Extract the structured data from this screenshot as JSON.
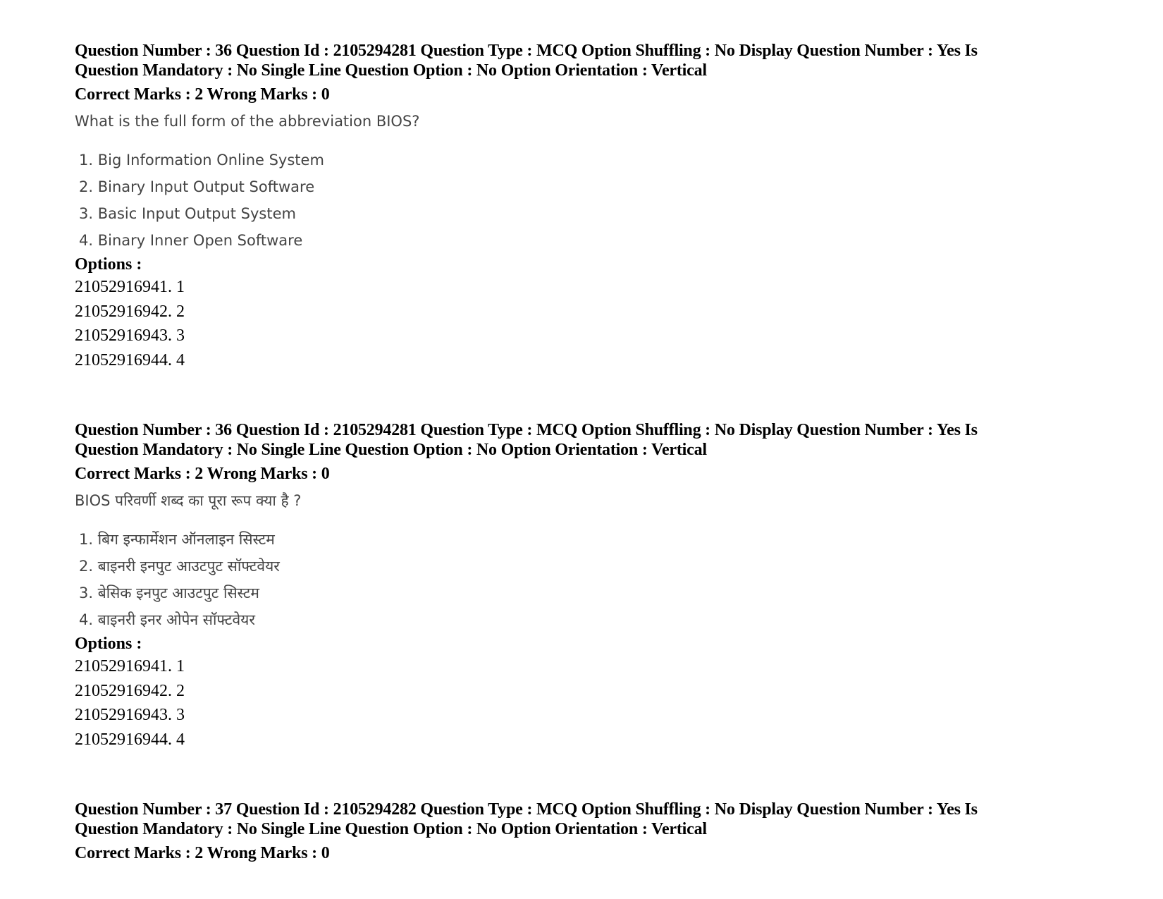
{
  "questions": [
    {
      "header_line1": "Question Number : 36 Question Id : 2105294281 Question Type : MCQ Option Shuffling : No Display Question Number : Yes Is",
      "header_line2": "Question Mandatory : No Single Line Question Option : No Option Orientation : Vertical",
      "marks": "Correct Marks : 2 Wrong Marks : 0",
      "question_text": "What is the full form of the abbreviation BIOS?",
      "choices": [
        "1. Big Information Online System",
        "2. Binary Input Output Software",
        "3. Basic Input Output System",
        "4. Binary Inner Open Software"
      ],
      "options_label": "Options :",
      "options": [
        "21052916941. 1",
        "21052916942. 2",
        "21052916943. 3",
        "21052916944. 4"
      ]
    },
    {
      "header_line1": "Question Number : 36 Question Id : 2105294281 Question Type : MCQ Option Shuffling : No Display Question Number : Yes Is",
      "header_line2": "Question Mandatory : No Single Line Question Option : No Option Orientation : Vertical",
      "marks": "Correct Marks : 2 Wrong Marks : 0",
      "question_text": "BIOS परिवर्णी शब्द का पूरा रूप क्या है ?",
      "choices": [
        "1. बिग इन्फार्मेशन ऑनलाइन सिस्टम",
        "2. बाइनरी इनपुट आउटपुट सॉफ्टवेयर",
        "3. बेसिक इनपुट आउटपुट सिस्टम",
        "4. बाइनरी इनर ओपेन सॉफ्टवेयर"
      ],
      "options_label": "Options :",
      "options": [
        "21052916941. 1",
        "21052916942. 2",
        "21052916943. 3",
        "21052916944. 4"
      ]
    },
    {
      "header_line1": "Question Number : 37 Question Id : 2105294282 Question Type : MCQ Option Shuffling : No Display Question Number : Yes Is",
      "header_line2": "Question Mandatory : No Single Line Question Option : No Option Orientation : Vertical",
      "marks": "Correct Marks : 2 Wrong Marks : 0"
    }
  ]
}
